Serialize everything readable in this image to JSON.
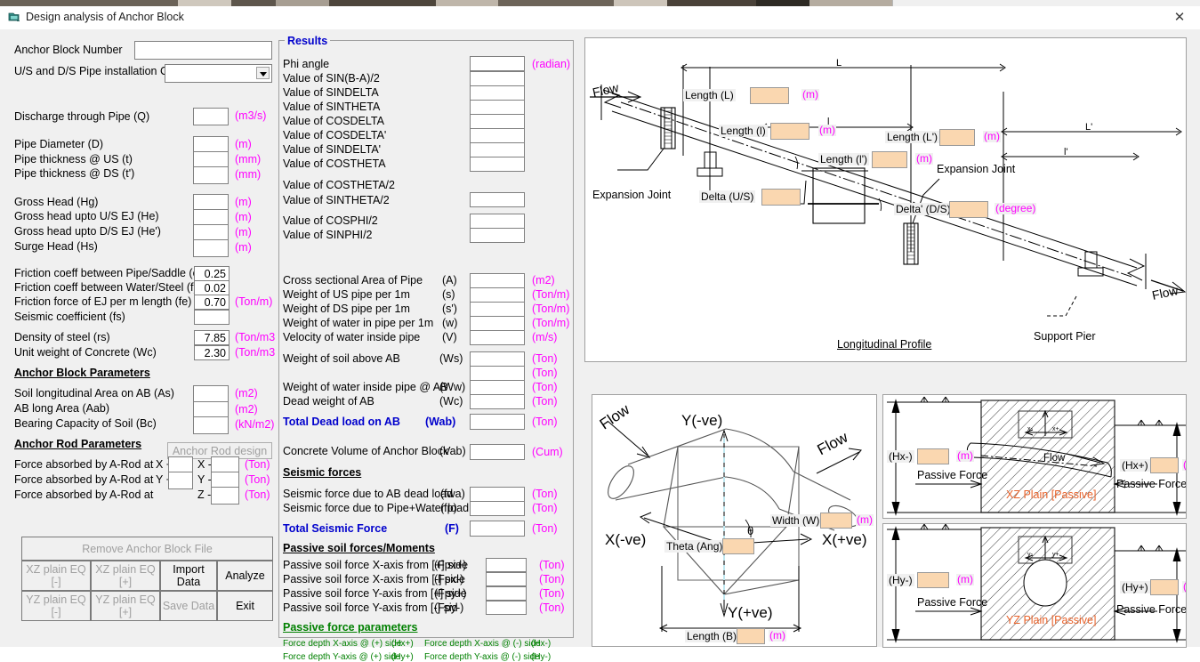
{
  "window": {
    "title": "Design analysis of Anchor Block",
    "icon": "form-icon",
    "close_label": "✕"
  },
  "input_panel": {
    "anchor_block_number": {
      "label": "Anchor Block Number",
      "value": ""
    },
    "install_case": {
      "label": "U/S and D/S Pipe installation Case",
      "value": ""
    },
    "rows_a": [
      {
        "label": "Discharge through Pipe (Q)",
        "value": "",
        "unit": "(m3/s)"
      }
    ],
    "rows_b": [
      {
        "label": "Pipe Diameter (D)",
        "value": "",
        "unit": "(m)"
      },
      {
        "label": "Pipe thickness @ US (t)",
        "value": "",
        "unit": "(mm)"
      },
      {
        "label": "Pipe thickness @ DS (t')",
        "value": "",
        "unit": "(mm)"
      }
    ],
    "rows_c": [
      {
        "label": "Gross Head (Hg)",
        "value": "",
        "unit": "(m)"
      },
      {
        "label": "Gross head upto U/S EJ (He)",
        "value": "",
        "unit": "(m)"
      },
      {
        "label": "Gross head upto D/S EJ (He')",
        "value": "",
        "unit": "(m)"
      },
      {
        "label": "Surge Head (Hs)",
        "value": "",
        "unit": "(m)"
      }
    ],
    "rows_d": [
      {
        "label": "Friction coeff between Pipe/Saddle (c)",
        "value": "0.25",
        "unit": ""
      },
      {
        "label": "Friction coeff between Water/Steel (f)",
        "value": "0.02",
        "unit": ""
      },
      {
        "label": "Friction force of EJ per m length (fe)",
        "value": "0.70",
        "unit": "(Ton/m)"
      },
      {
        "label": "Seismic coefficient (fs)",
        "value": "",
        "unit": ""
      }
    ],
    "rows_e": [
      {
        "label": "Density of steel (rs)",
        "value": "7.85",
        "unit": "(Ton/m3"
      },
      {
        "label": "Unit weight of Concrete (Wc)",
        "value": "2.30",
        "unit": "(Ton/m3"
      }
    ],
    "ab_params_heading": "Anchor Block Parameters",
    "rows_f": [
      {
        "label": "Soil longitudinal Area on AB (As)",
        "value": "",
        "unit": "(m2)"
      },
      {
        "label": "AB long Area (Aab)",
        "value": "",
        "unit": "(m2)"
      },
      {
        "label": "Bearing Capacity of Soil (Bc)",
        "value": "",
        "unit": "(kN/m2)"
      }
    ],
    "rod_params_heading": "Anchor Rod Parameters",
    "rod_design_button": "Anchor Rod design",
    "rod_rows": [
      {
        "label": "Force absorbed by A-Rod at",
        "axis_pos": "X +",
        "value_pos": "",
        "axis_neg": "X -",
        "value_neg": "",
        "unit": "(Ton)"
      },
      {
        "label": "Force absorbed by A-Rod at",
        "axis_pos": "Y +",
        "value_pos": "",
        "axis_neg": "Y -",
        "value_neg": "",
        "unit": "(Ton)"
      },
      {
        "label": "Force absorbed by A-Rod at",
        "axis_pos": "",
        "value_pos": "",
        "axis_neg": "Z -",
        "value_neg": "",
        "unit": "(Ton)"
      }
    ]
  },
  "buttons": {
    "remove_file": {
      "label": "Remove Anchor Block File",
      "enabled": false
    },
    "xz_minus": {
      "label": "XZ plain EQ [-]",
      "enabled": false
    },
    "xz_plus": {
      "label": "XZ plain EQ [+]",
      "enabled": false
    },
    "import_data": {
      "label": "Import Data",
      "enabled": true
    },
    "analyze": {
      "label": "Analyze",
      "enabled": true
    },
    "yz_minus": {
      "label": "YZ plain EQ [-]",
      "enabled": false
    },
    "yz_plus": {
      "label": "YZ plain EQ [+]",
      "enabled": false
    },
    "save_data": {
      "label": "Save Data",
      "enabled": false
    },
    "exit": {
      "label": "Exit",
      "enabled": true
    }
  },
  "results": {
    "caption": "Results",
    "group1": [
      {
        "label": "Phi angle",
        "value": "",
        "unit": "(radian)"
      },
      {
        "label": "Value of SIN(B-A)/2",
        "value": "",
        "unit": ""
      },
      {
        "label": "Value of SINDELTA",
        "value": "",
        "unit": ""
      },
      {
        "label": "Value of SINTHETA",
        "value": "",
        "unit": ""
      },
      {
        "label": "Value of COSDELTA",
        "value": "",
        "unit": ""
      },
      {
        "label": "Value of COSDELTA'",
        "value": "",
        "unit": ""
      },
      {
        "label": "Value of SINDELTA'",
        "value": "",
        "unit": ""
      },
      {
        "label": "Value of COSTHETA",
        "value": "",
        "unit": ""
      }
    ],
    "group2_labels": [
      {
        "label": "Value of COSTHETA/2"
      },
      {
        "label": "Value of SINTHETA/2"
      }
    ],
    "group2_value": "",
    "group3": [
      {
        "label": "Value of COSPHI/2",
        "value": ""
      },
      {
        "label": "Value of SINPHI/2",
        "value": ""
      }
    ],
    "group4": [
      {
        "label": "Cross sectional Area of Pipe",
        "sym": "(A)",
        "value": "",
        "unit": "(m2)"
      },
      {
        "label": "Weight of US pipe per 1m",
        "sym": "(s)",
        "value": "",
        "unit": "(Ton/m)"
      },
      {
        "label": "Weight of DS pipe per 1m",
        "sym": "(s')",
        "value": "",
        "unit": "(Ton/m)"
      },
      {
        "label": "Weight of water in pipe per 1m",
        "sym": "(w)",
        "value": "",
        "unit": "(Ton/m)"
      },
      {
        "label": "Velocity of water inside pipe",
        "sym": "(V)",
        "value": "",
        "unit": "(m/s)"
      }
    ],
    "group5": [
      {
        "label": "Weight of soil above AB",
        "sym": "(Ws)",
        "value": "",
        "unit": "(Ton)"
      },
      {
        "label": "",
        "sym": "",
        "value": "",
        "unit": "(Ton)"
      },
      {
        "label": "Weight of water inside pipe @ AB",
        "sym": "(Ww)",
        "value": "",
        "unit": "(Ton)"
      },
      {
        "label": "Dead weight of AB",
        "sym": "(Wc)",
        "value": "",
        "unit": "(Ton)"
      }
    ],
    "total_dead_load": {
      "label": "Total Dead load on AB",
      "sym": "(Wab)",
      "value": "",
      "unit": "(Ton)"
    },
    "concrete_volume": {
      "label": "Concrete Volume of Anchor Block",
      "sym": "(Vab)",
      "value": "",
      "unit": "(Cum)"
    },
    "seismic_heading": "Seismic forces",
    "seismic_rows": [
      {
        "label": "Seismic force due to AB dead load",
        "sym": "(fwa)",
        "value": "",
        "unit": "(Ton)"
      },
      {
        "label": "Seismic force due to Pipe+Water load",
        "sym": "(fp)",
        "value": "",
        "unit": "(Ton)"
      }
    ],
    "total_seismic": {
      "label": "Total Seismic Force",
      "sym": "(F)",
      "value": "",
      "unit": "(Ton)"
    },
    "passive_heading": "Passive soil forces/Moments",
    "passive_rows": [
      {
        "label": "Passive soil force X-axis from [+] side",
        "sym": "(Fpx+)",
        "value": "",
        "unit": "(Ton)"
      },
      {
        "label": "Passive soil force X-axis from  [-] side",
        "sym": "(Fpx-)",
        "value": "",
        "unit": "(Ton)"
      },
      {
        "label": "Passive soil force Y-axis from [+] side",
        "sym": "(Fpy+)",
        "value": "",
        "unit": "(Ton)"
      },
      {
        "label": "Passive soil force Y-axis from [-] sid",
        "sym": "(Fpy-)",
        "value": "",
        "unit": "(Ton)"
      }
    ],
    "passive_param_heading": "Passive force parameters",
    "passive_params": [
      {
        "left_label": "Force depth X-axis @ (+) side",
        "left_sym": "(Hx+)",
        "right_label": "Force depth X-axis @ (-) side",
        "right_sym": "(Hx-)"
      },
      {
        "left_label": "Force depth Y-axis @ (+) side",
        "left_sym": "(Hy+)",
        "right_label": "Force depth Y-axis @ (-) side",
        "right_sym": "(Hy-)"
      }
    ]
  },
  "longitudinal_profile": {
    "caption": "Longitudinal Profile",
    "flow_in": "Flow",
    "flow_out": "Flow",
    "expansion_joint_left": "Expansion Joint",
    "expansion_joint_right": "Expansion Joint",
    "support_pier": "Support Pier",
    "fields": [
      {
        "label": "Length (L)",
        "value": "",
        "unit": "(m)",
        "dim": "L"
      },
      {
        "label": "Length (l)",
        "value": "",
        "unit": "(m)",
        "dim": "l"
      },
      {
        "label": "Length (L')",
        "value": "",
        "unit": "(m)",
        "dim": "L'"
      },
      {
        "label": "Length (l')",
        "value": "",
        "unit": "(m)",
        "dim": "l'"
      },
      {
        "label": "Delta (U/S)",
        "value": "",
        "unit": "",
        "dim": ""
      },
      {
        "label": "Delta' (D/S)",
        "value": "",
        "unit": "(degree)",
        "dim": ""
      }
    ]
  },
  "plan_view": {
    "flow_in": "Flow",
    "flow_out": "Flow",
    "axis_y_neg": "Y(-ve)",
    "axis_y_pos": "Y(+ve)",
    "axis_x_neg": "X(-ve)",
    "axis_x_pos": "X(+ve)",
    "theta_symbol": "θ",
    "fields": [
      {
        "label": "Width (W)",
        "value": "",
        "unit": "(m)"
      },
      {
        "label": "Theta (Ang)",
        "value": "",
        "unit": ""
      },
      {
        "label": "Length (B)",
        "value": "",
        "unit": "(m)"
      }
    ]
  },
  "xz_plain": {
    "title": "XZ Plain [Passive]",
    "flow": "Flow",
    "left": {
      "sym": "(Hx-)",
      "value": "",
      "unit": "(m)",
      "force_label": "Passive Force"
    },
    "right": {
      "sym": "(Hx+)",
      "value": "",
      "unit": "(m",
      "force_label": "Passive Force"
    },
    "axis_minus": "x-",
    "axis_plus": "x+"
  },
  "yz_plain": {
    "title": "YZ Plain [Passive]",
    "left": {
      "sym": "(Hy-)",
      "value": "",
      "unit": "(m)",
      "force_label": "Passive Force"
    },
    "right": {
      "sym": "(Hy+)",
      "value": "",
      "unit": "(m",
      "force_label": "Passive Force"
    },
    "axis_minus": "y-",
    "axis_plus": "y+"
  },
  "colors": {
    "unit_magenta": "#ff00ff",
    "heading_blue": "#0000cc",
    "green": "#008000",
    "orange": "#e8622a",
    "field_peach": "#fad7b0",
    "window_bg": "#f0f0f0"
  }
}
